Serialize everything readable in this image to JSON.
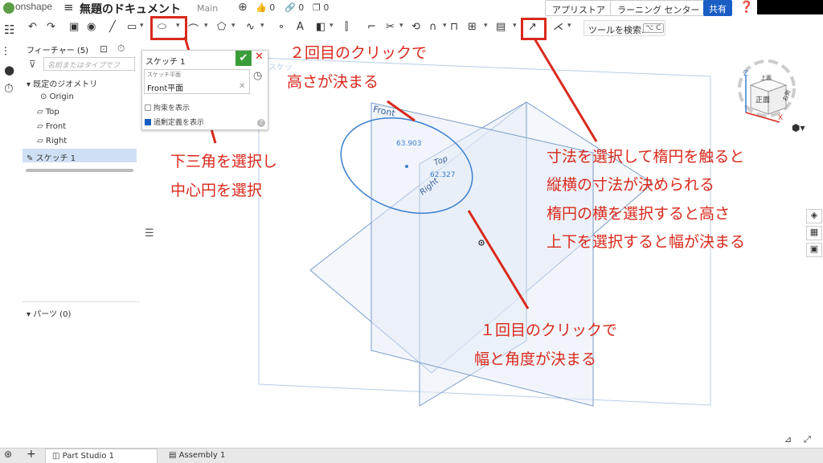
{
  "app": {
    "logo_text": "onshape",
    "doc_title": "無題のドキュメント",
    "branch": "Main",
    "likes": "0",
    "links": "0",
    "copies": "0",
    "appstore_label": "アプリストア",
    "learning_label": "ラーニング センター",
    "share_label": "共有"
  },
  "toolbar": {
    "search_label": "ツールを検索...",
    "shortcut": "⌥ C"
  },
  "features": {
    "title": "フィーチャー (5)",
    "filter_placeholder": "名前またはタイプでフ",
    "default_geometry": "既定のジオメトリ",
    "origin": "Origin",
    "top": "Top",
    "front": "Front",
    "right": "Right",
    "sketch": "スケッチ 1",
    "parts": "パーツ (0)"
  },
  "sketch_dialog": {
    "name": "スケッチ 1",
    "plane_label": "スケッチ平面",
    "plane_value": "Front平面",
    "show_constraints": "拘束を表示",
    "show_overdefined": "過剰定義を表示",
    "help": "?"
  },
  "viewport": {
    "plane_front": "Front",
    "plane_top": "Top",
    "plane_right": "Right",
    "sketch_ghost": "スケッ",
    "dim_1": "63.903",
    "dim_2": "62.327"
  },
  "viewcube": {
    "front": "正面",
    "top": "上面",
    "right": "右側",
    "z": "Z",
    "x": "X"
  },
  "annotations": {
    "select_tri_1": "下三角を選択し",
    "select_tri_2": "中心円を選択",
    "second_click_1": "２回目のクリックで",
    "second_click_2": "高さが決まる",
    "first_click_1": "１回目のクリックで",
    "first_click_2": "幅と角度が決まる",
    "dim_note_1": "寸法を選択して楕円を触ると",
    "dim_note_2": "縦横の寸法が決められる",
    "dim_note_3": "楕円の横を選択すると高さ",
    "dim_note_4": "上下を選択すると幅が決まる"
  },
  "tabs": {
    "part_studio": "Part Studio 1",
    "assembly": "Assembly 1"
  },
  "colors": {
    "annotation_red": "#d9291c",
    "share_blue": "#1a5ec4",
    "ok_green": "#3a9d3a",
    "plane_blue": "#7a9cc8"
  }
}
